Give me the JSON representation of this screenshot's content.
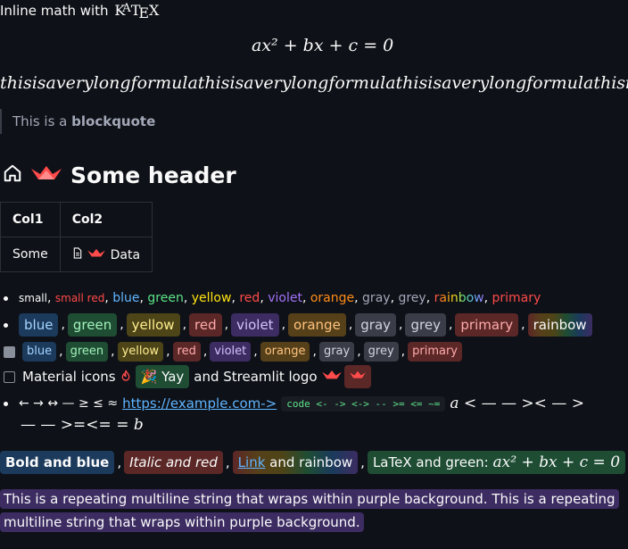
{
  "top": {
    "inline_math_label": "Inline math with",
    "katex_logo": "KaTeX",
    "equation_display": "ax² + bx + c = 0",
    "long_formula": "thisisaverylongformulathisisaverylongformulathisisaverylongformulathisisaverylongformula"
  },
  "blockquote": {
    "prefix": "This is a ",
    "bold": "blockquote"
  },
  "header": {
    "title": "Some header"
  },
  "table": {
    "headers": [
      "Col1",
      "Col2"
    ],
    "row": [
      "Some",
      "Data"
    ]
  },
  "line1": {
    "small": "small",
    "small_red": "small red",
    "blue": "blue",
    "green": "green",
    "yellow": "yellow",
    "red": "red",
    "violet": "violet",
    "orange": "orange",
    "gray": "gray",
    "grey": "grey",
    "rainbow": "rainbow",
    "primary": "primary"
  },
  "line2": {
    "blue": "blue",
    "green": "green",
    "yellow": "yellow",
    "red": "red",
    "violet": "violet",
    "orange": "orange",
    "gray": "gray",
    "grey": "grey",
    "primary": "primary",
    "rainbow": "rainbow"
  },
  "line3": {
    "blue": "blue",
    "green": "green",
    "yellow": "yellow",
    "red": "red",
    "violet": "violet",
    "orange": "orange",
    "gray": "gray",
    "grey": "grey",
    "primary": "primary"
  },
  "line4": {
    "material_label": "Material icons",
    "yay": "Yay",
    "logo_label": "and Streamlit logo"
  },
  "line5": {
    "arrows": "← → ↔ — ≥ ≤ ≈",
    "link": "https://example.com->",
    "code": "code <- -> <-> -- >= <= ~=",
    "math_1": "a < — — >< — >",
    "math_2": "— — >=<= = b"
  },
  "mixed": {
    "bold_blue": "Bold and blue",
    "italic_red": "Italic and red",
    "link": "Link",
    "rainbow_suffix": " and rainbow",
    "latex_green": "LaTeX and green: ",
    "latex_eq": "ax² + bx + c = 0"
  },
  "purple_text": "This is a repeating multiline string that wraps within purple background. This is a repeating multiline string that wraps within purple background.",
  "colors": {
    "background": "#0e1117",
    "blue": "#60b4ff",
    "green": "#5ce488",
    "red": "#ff4b4b",
    "violet": "#a371f7",
    "orange": "#ff8c1a"
  }
}
